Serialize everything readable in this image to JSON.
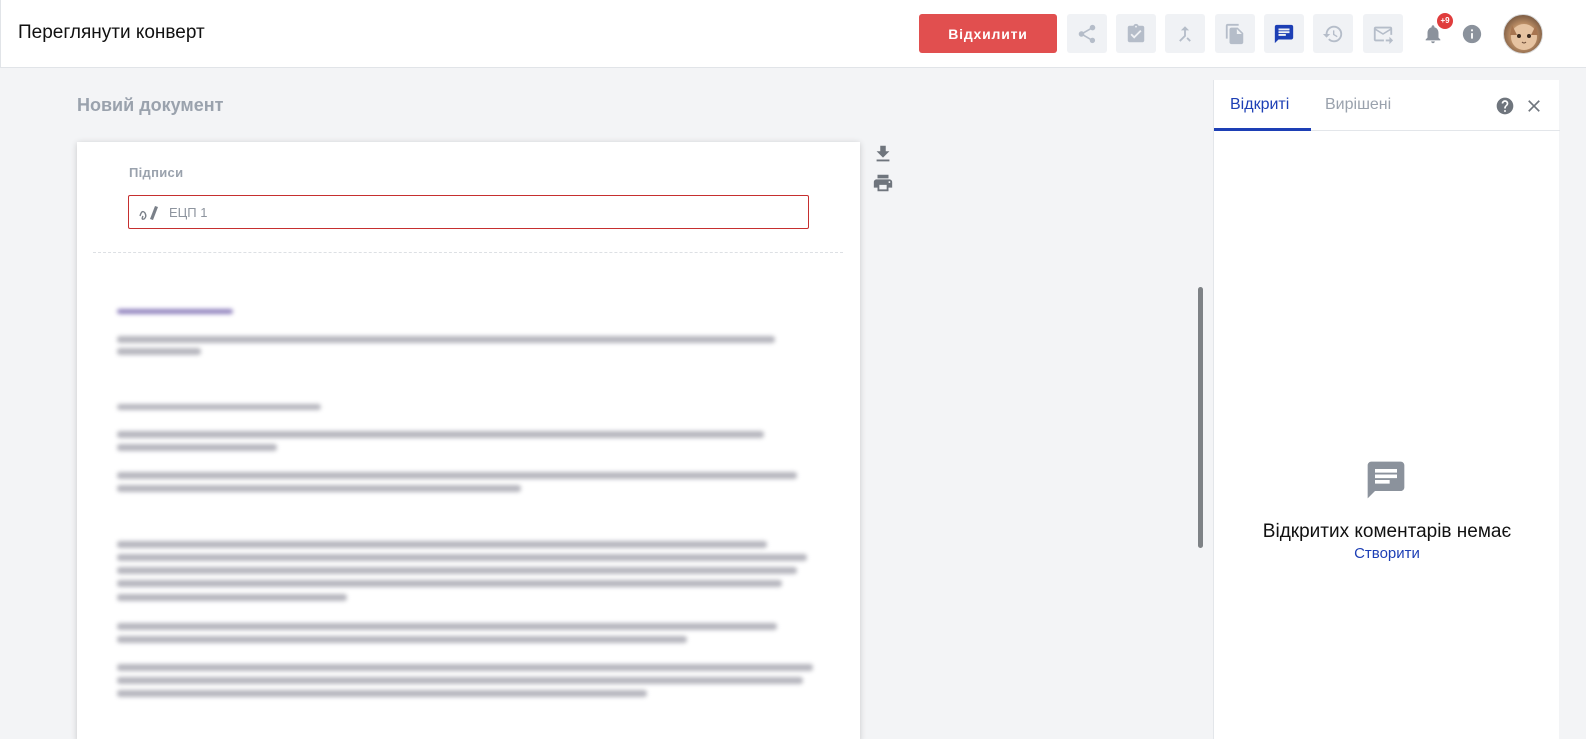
{
  "header": {
    "title": "Переглянути конверт",
    "reject_label": "Відхилити",
    "notification_badge": "+9",
    "toolbar_icons": [
      "share-icon",
      "assignment-check-icon",
      "merge-icon",
      "copy-icon",
      "comment-icon",
      "history-icon",
      "mail-forward-icon"
    ],
    "active_icon": "comment-icon"
  },
  "document": {
    "title": "Новий документ",
    "signatures_label": "Підписи",
    "signature_field": "ЕЦП 1"
  },
  "comments_panel": {
    "tabs": [
      {
        "label": "Відкриті",
        "active": true
      },
      {
        "label": "Вирішені",
        "active": false
      }
    ],
    "empty_message": "Відкритих коментарів немає",
    "create_label": "Створити"
  },
  "colors": {
    "accent": "#1d3fb5",
    "danger": "#e14f4f",
    "muted": "#9aa2ad"
  }
}
